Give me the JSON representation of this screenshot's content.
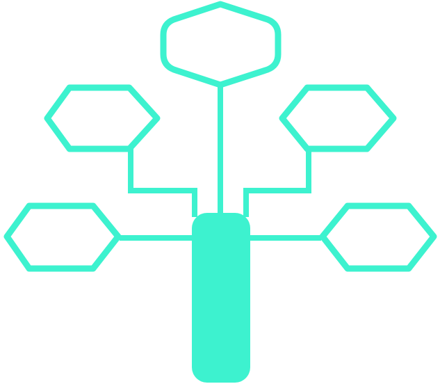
{
  "diagram": {
    "accent_color": "#3df2cf",
    "background_color": "#ffffff",
    "trunk_shape": "rounded-bar",
    "node_shape": "hexagon-outline",
    "node_count": 5,
    "connector_style": "orthogonal-lines"
  }
}
